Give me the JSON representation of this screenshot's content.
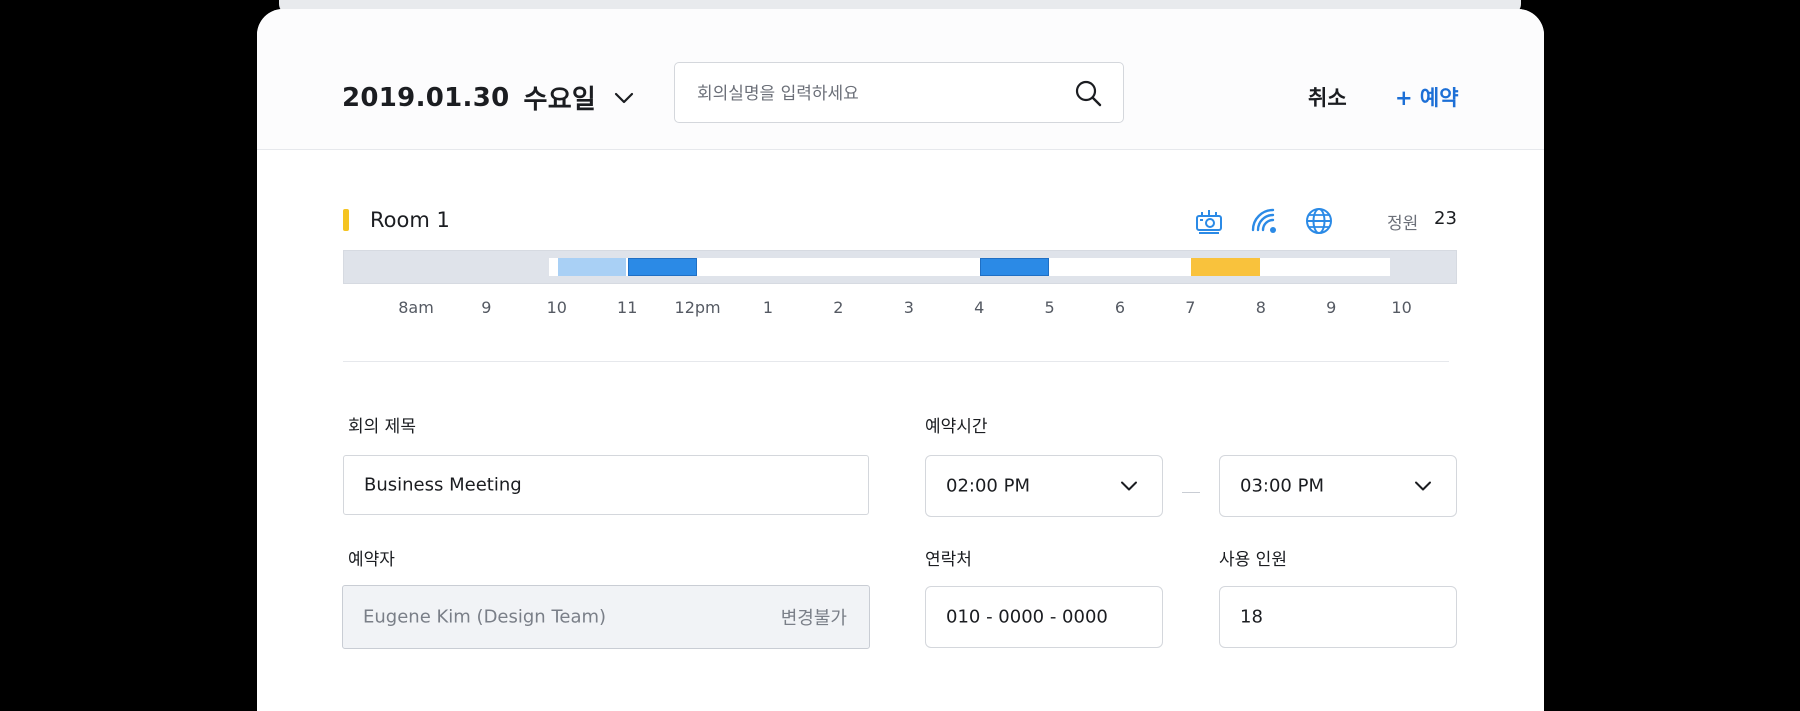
{
  "header": {
    "date": "2019.01.30",
    "weekday": "수요일",
    "search_placeholder": "회의실명을 입력하세요",
    "cancel_label": "취소",
    "reserve_label": "+ 예약"
  },
  "room": {
    "name": "Room 1",
    "amenities": [
      "projector-icon",
      "wifi-icon",
      "globe-icon"
    ],
    "capacity_label": "정원",
    "capacity_value": "23",
    "accent_color": "#f5c421"
  },
  "timeline": {
    "ticks": [
      "8am",
      "9",
      "10",
      "11",
      "12pm",
      "1",
      "2",
      "3",
      "4",
      "5",
      "6",
      "7",
      "8",
      "9",
      "10"
    ],
    "bookings": [
      {
        "start": "10:00",
        "end": "11:00",
        "status": "selected",
        "color": "#a9d0f5"
      },
      {
        "start": "11:00",
        "end": "12:00",
        "status": "booked",
        "color": "#2b8ae6"
      },
      {
        "start": "16:00",
        "end": "17:00",
        "status": "booked",
        "color": "#2b8ae6"
      },
      {
        "start": "19:00",
        "end": "20:00",
        "status": "highlight",
        "color": "#f9c23c"
      }
    ]
  },
  "form": {
    "title_label": "회의 제목",
    "title_value": "Business Meeting",
    "time_label": "예약시간",
    "start_time": "02:00 PM",
    "end_time": "03:00 PM",
    "booker_label": "예약자",
    "booker_value": "Eugene Kim (Design Team)",
    "booker_note": "변경불가",
    "contact_label": "연락처",
    "contact_value": "010 - 0000 - 0000",
    "attendees_label": "사용 인원",
    "attendees_value": "18"
  },
  "colors": {
    "accent_blue": "#1c6fd6",
    "booked_blue": "#2b8ae6",
    "light_blue": "#a9d0f5",
    "yellow": "#f9c23c"
  }
}
